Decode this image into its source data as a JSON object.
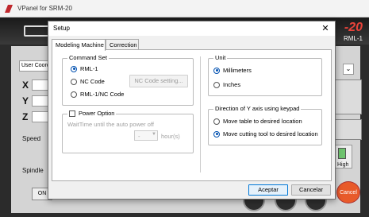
{
  "app": {
    "window_title": "VPanel for SRM-20",
    "model": "-20",
    "model_sub": "RML-1",
    "user_coord": "User Coord",
    "axes": [
      "X",
      "Y",
      "Z"
    ],
    "speed_label": "Speed",
    "spindle_label": "Spindle",
    "on_label": "ON",
    "high_label": "High",
    "cancel_label": "Cancel",
    "dropdown_arrow": "⌄"
  },
  "dialog": {
    "title": "Setup",
    "close_glyph": "✕",
    "tabs": [
      {
        "label": "Modeling Machine",
        "active": true
      },
      {
        "label": "Correction",
        "active": false
      }
    ],
    "command_set": {
      "title": "Command Set",
      "options": [
        "RML-1",
        "NC Code",
        "RML-1/NC Code"
      ],
      "selected": "RML-1",
      "nc_setting_button": "NC Code setting..."
    },
    "power_option": {
      "title": "Power Option",
      "checked": false,
      "wait_label": "WaitTime until the auto power off",
      "value": "-",
      "unit": "hour(s)"
    },
    "unit": {
      "title": "Unit",
      "options": [
        "Millimeters",
        "Inches"
      ],
      "selected": "Millimeters"
    },
    "y_direction": {
      "title": "Direction of Y axis using keypad",
      "options": [
        "Move table to desired location",
        "Move cutting tool to desired location"
      ],
      "selected": "Move cutting tool to desired location"
    },
    "ok_button": "Aceptar",
    "cancel_button": "Cancelar"
  },
  "colors": {
    "accent": "#0078d7",
    "radio_selected": "#0050b0",
    "model_red": "#e8433a",
    "cancel_orange": "#e85a2a"
  }
}
